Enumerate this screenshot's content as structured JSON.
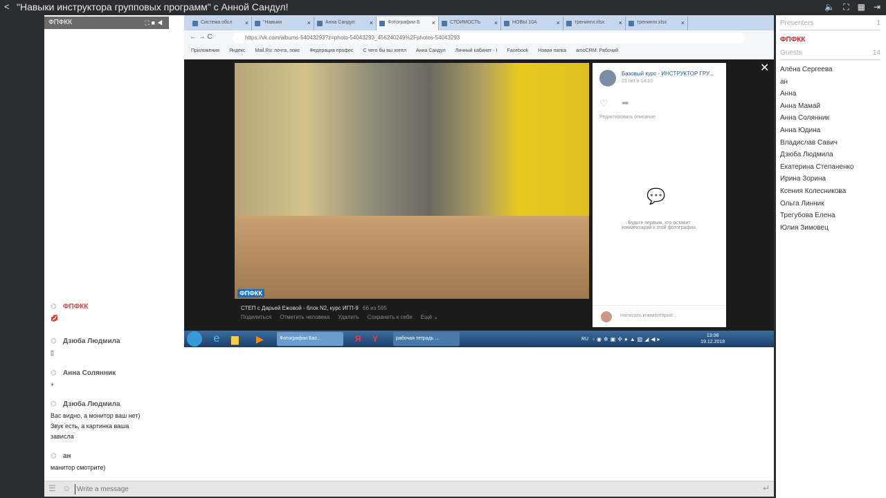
{
  "topbar": {
    "title": "\"Навыки инструктора групповых программ\" с Анной Сандул!"
  },
  "cam": {
    "name": "ФПФКК"
  },
  "browser": {
    "tabs": [
      "Система обсл",
      "\"Навыки",
      "Анна Сандул",
      "Фотографии Б",
      "СТОИМОСТЬ",
      "НОВЫ 10А",
      "тренинги.xlsx",
      "тренинги.xlsx"
    ],
    "url": "https://vk.com/albums-54043293?z=photo-54043293_456240249%2Fphotos-54043293",
    "bookmarks": [
      "Приложения",
      "Яндекс",
      "Mail.Ru: почта, поис",
      "Федерация профес",
      "С чего бы вы хотел",
      "Анна Сандул",
      "Личный кабинет - I",
      "Facebook",
      "Новая папка",
      "amoCRM: Рабочий"
    ]
  },
  "vk": {
    "group": "Базовый курс - ИНСТРУКТОР ГРУ...",
    "date": "23 окт в 14:10",
    "edit": "Редактировать описание",
    "empty": "Будьте первым, кто оставит комментарий к этой фотографии.",
    "comment_placeholder": "Написать комментарий...",
    "caption": "СТЕП с Дарьей Ежовой - блок N2, курс ИГП-9",
    "counter": "66 из 595",
    "actions": [
      "Поделиться",
      "Отметить человека",
      "Удалить",
      "Сохранить к себе",
      "Ещё ⌄"
    ],
    "logo": "ФПФКК"
  },
  "taskbar": {
    "chrome": "Фотографии Баз...",
    "word": "рабочая тетрадь ...",
    "lang": "RU",
    "time": "13:08",
    "date": "19.12.2018"
  },
  "chat": [
    {
      "name": "ФПФКК",
      "lines": [
        "💋"
      ],
      "presenter": true
    },
    {
      "name": "Дзюба Людмила",
      "lines": [
        "▯"
      ]
    },
    {
      "name": "Анна Солянник",
      "lines": [
        "+"
      ]
    },
    {
      "name": "Дзюба Людмила",
      "lines": [
        "Вас видно, а монитор ваш нет)",
        "Звук есть, а картинка ваша",
        "зависла"
      ]
    },
    {
      "name": "ан",
      "lines": [
        "манитор смотрите)"
      ]
    }
  ],
  "input": {
    "placeholder": "Write a message"
  },
  "users": {
    "presenters_label": "Presenters",
    "presenters_count": "1",
    "presenter": "ФПФКК",
    "guests_label": "Guests",
    "guests_count": "14",
    "guests": [
      "Алёна Сергеева",
      "ан",
      "Анна",
      "Анна Мамай",
      "Анна Солянник",
      "Анна Юдина",
      "Владислав Савич",
      "Дзюба Людмила",
      "Екатерина Степаненко",
      "Ирина Зорина",
      "Ксения Колесникова",
      "Ольга Линник",
      "Трегубова Елена",
      "Юлия Зимовец"
    ]
  },
  "colors": {
    "presenter": "#c8262b",
    "bg": "#2b2d31"
  }
}
